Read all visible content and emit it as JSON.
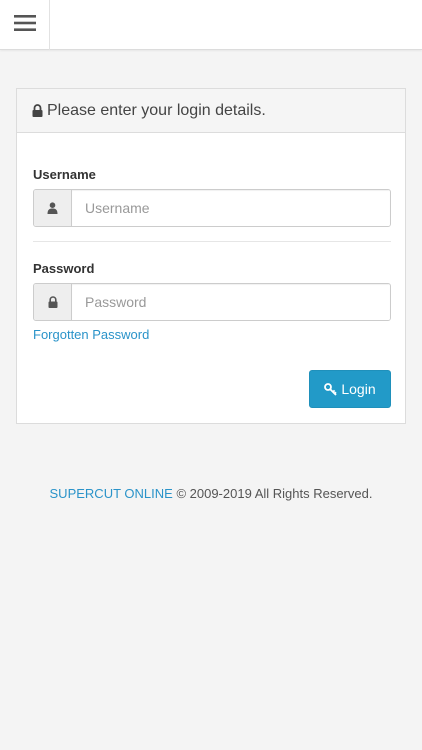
{
  "header": {
    "menu_icon": "hamburger-menu-icon"
  },
  "login_panel": {
    "heading": "Please enter your login details.",
    "heading_icon": "lock-icon",
    "username": {
      "label": "Username",
      "placeholder": "Username",
      "value": "",
      "icon": "user-icon"
    },
    "password": {
      "label": "Password",
      "placeholder": "Password",
      "value": "",
      "icon": "lock-icon"
    },
    "forgot_link": "Forgotten Password",
    "login_button": {
      "label": "Login",
      "icon": "key-icon"
    }
  },
  "footer": {
    "brand": "SUPERCUT ONLINE",
    "copyright": "© 2009-2019 All Rights Reserved."
  },
  "colors": {
    "accent": "#229ac8",
    "link": "#2a93c9",
    "page_background": "#f4f4f4"
  }
}
